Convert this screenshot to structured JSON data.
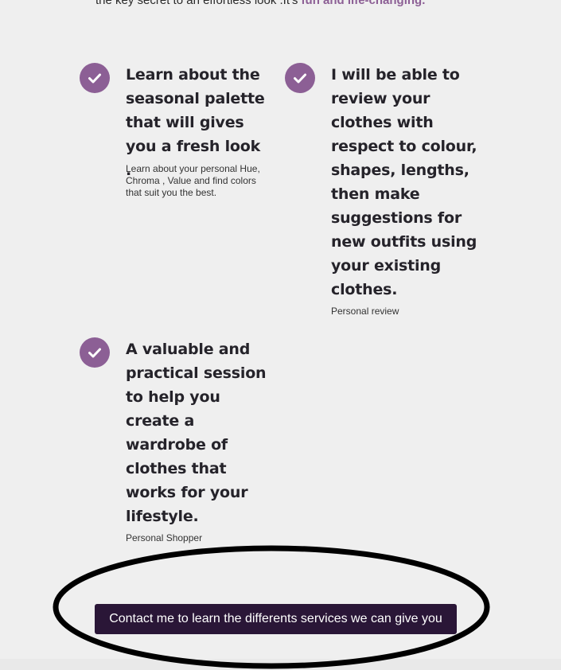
{
  "intro": {
    "text": "the key secret to an effortless look .It's ",
    "highlight": "fun and life-changing."
  },
  "features": [
    {
      "icon": "check-icon",
      "title": "Learn about the seasonal palette that will gives you a fresh look .",
      "description": "Learn about your personal Hue, Chroma , Value and find colors that suit you the best."
    },
    {
      "icon": "check-icon",
      "title": "I will be able to review your clothes with respect to colour, shapes, lengths, then make suggestions for new outfits using your existing clothes.",
      "description": "Personal review"
    },
    {
      "icon": "check-icon",
      "title": "A valuable and practical session to help you create a wardrobe of clothes that works for your lifestyle.",
      "description": "Personal Shopper"
    }
  ],
  "cta": {
    "label": "Contact me to learn the differents services we can give you"
  },
  "colors": {
    "accent": "#8c5f95",
    "button_bg": "#2a1637",
    "page_bg": "#efefef",
    "annotation_ellipse": "#000000"
  }
}
